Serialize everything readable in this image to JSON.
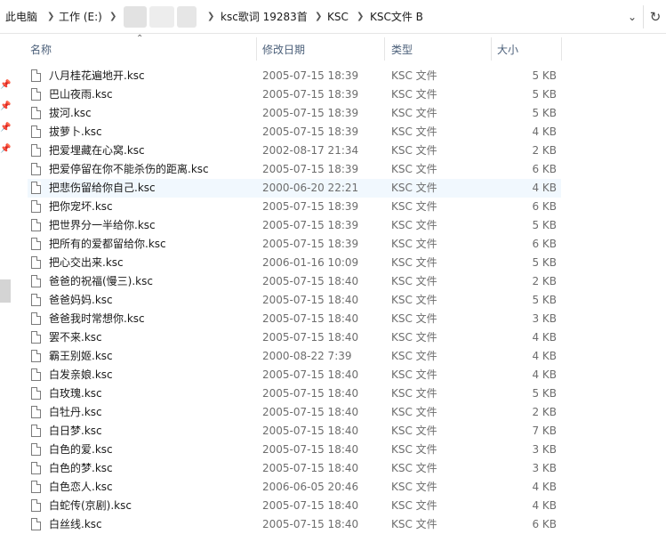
{
  "breadcrumb": {
    "items": [
      "此电脑",
      "工作 (E:)",
      "ksc歌词 19283首",
      "KSC",
      "KSC文件 B"
    ]
  },
  "columns": {
    "name": "名称",
    "date": "修改日期",
    "type": "类型",
    "size": "大小"
  },
  "files": [
    {
      "name": "八月桂花遍地开.ksc",
      "date": "2005-07-15 18:39",
      "type": "KSC 文件",
      "size": "5 KB"
    },
    {
      "name": "巴山夜雨.ksc",
      "date": "2005-07-15 18:39",
      "type": "KSC 文件",
      "size": "5 KB"
    },
    {
      "name": "拔河.ksc",
      "date": "2005-07-15 18:39",
      "type": "KSC 文件",
      "size": "5 KB"
    },
    {
      "name": "拔萝卜.ksc",
      "date": "2005-07-15 18:39",
      "type": "KSC 文件",
      "size": "4 KB"
    },
    {
      "name": "把爱埋藏在心窝.ksc",
      "date": "2002-08-17 21:34",
      "type": "KSC 文件",
      "size": "2 KB"
    },
    {
      "name": "把爱停留在你不能杀伤的距离.ksc",
      "date": "2005-07-15 18:39",
      "type": "KSC 文件",
      "size": "6 KB"
    },
    {
      "name": "把悲伤留给你自己.ksc",
      "date": "2000-06-20 22:21",
      "type": "KSC 文件",
      "size": "4 KB"
    },
    {
      "name": "把你宠坏.ksc",
      "date": "2005-07-15 18:39",
      "type": "KSC 文件",
      "size": "6 KB"
    },
    {
      "name": "把世界分一半给你.ksc",
      "date": "2005-07-15 18:39",
      "type": "KSC 文件",
      "size": "5 KB"
    },
    {
      "name": "把所有的爱都留给你.ksc",
      "date": "2005-07-15 18:39",
      "type": "KSC 文件",
      "size": "6 KB"
    },
    {
      "name": "把心交出来.ksc",
      "date": "2006-01-16 10:09",
      "type": "KSC 文件",
      "size": "5 KB"
    },
    {
      "name": "爸爸的祝福(慢三).ksc",
      "date": "2005-07-15 18:40",
      "type": "KSC 文件",
      "size": "2 KB"
    },
    {
      "name": "爸爸妈妈.ksc",
      "date": "2005-07-15 18:40",
      "type": "KSC 文件",
      "size": "5 KB"
    },
    {
      "name": "爸爸我时常想你.ksc",
      "date": "2005-07-15 18:40",
      "type": "KSC 文件",
      "size": "3 KB"
    },
    {
      "name": "罢不来.ksc",
      "date": "2005-07-15 18:40",
      "type": "KSC 文件",
      "size": "4 KB"
    },
    {
      "name": "霸王别姬.ksc",
      "date": "2000-08-22 7:39",
      "type": "KSC 文件",
      "size": "4 KB"
    },
    {
      "name": "白发亲娘.ksc",
      "date": "2005-07-15 18:40",
      "type": "KSC 文件",
      "size": "4 KB"
    },
    {
      "name": "白玫瑰.ksc",
      "date": "2005-07-15 18:40",
      "type": "KSC 文件",
      "size": "5 KB"
    },
    {
      "name": "白牡丹.ksc",
      "date": "2005-07-15 18:40",
      "type": "KSC 文件",
      "size": "2 KB"
    },
    {
      "name": "白日梦.ksc",
      "date": "2005-07-15 18:40",
      "type": "KSC 文件",
      "size": "7 KB"
    },
    {
      "name": "白色的爱.ksc",
      "date": "2005-07-15 18:40",
      "type": "KSC 文件",
      "size": "3 KB"
    },
    {
      "name": "白色的梦.ksc",
      "date": "2005-07-15 18:40",
      "type": "KSC 文件",
      "size": "3 KB"
    },
    {
      "name": "白色恋人.ksc",
      "date": "2006-06-05 20:46",
      "type": "KSC 文件",
      "size": "4 KB"
    },
    {
      "name": "白蛇传(京剧).ksc",
      "date": "2005-07-15 18:40",
      "type": "KSC 文件",
      "size": "4 KB"
    },
    {
      "name": "白丝线.ksc",
      "date": "2005-07-15 18:40",
      "type": "KSC 文件",
      "size": "6 KB"
    }
  ],
  "selected_index": 6,
  "icons": {
    "file": "file-icon",
    "pin": "pin-icon",
    "breadcrumb_separator": "chevron-right-icon",
    "dropdown": "chevron-down-icon",
    "refresh": "refresh-icon",
    "sort": "sort-ascending-icon"
  },
  "colors": {
    "header_text": "#4c607a",
    "selected_row": "#f1f8fe",
    "secondary_text": "#6d6d6d"
  }
}
